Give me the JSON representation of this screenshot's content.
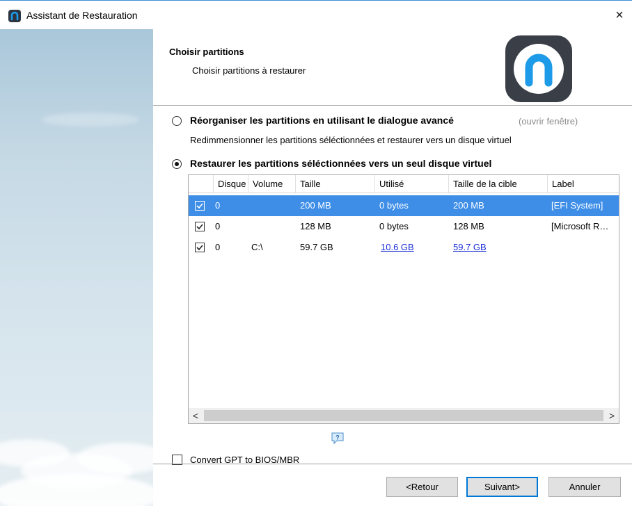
{
  "window": {
    "title": "Assistant de Restauration",
    "close_glyph": "×"
  },
  "header": {
    "title": "Choisir partitions",
    "subtitle": "Choisir partitions à restaurer"
  },
  "options": [
    {
      "label": "Réorganiser les partitions en utilisant le dialogue avancé",
      "link": "(ouvrir fenêtre)",
      "description": "Redimmensionner les partitions séléctionnées et restaurer vers un disque virtuel",
      "checked": false
    },
    {
      "label": "Restaurer les partitions séléctionnées vers un seul disque virtuel",
      "checked": true
    }
  ],
  "table": {
    "columns": [
      "Disque",
      "Volume",
      "Taille",
      "Utilisé",
      "Taille de la cible",
      "Label"
    ],
    "rows": [
      {
        "disk": "0",
        "volume": "",
        "size": "200 MB",
        "used": "0 bytes",
        "target": "200 MB",
        "label": "[EFI System]",
        "checked": true,
        "selected": true
      },
      {
        "disk": "0",
        "volume": "",
        "size": "128 MB",
        "used": "0 bytes",
        "target": "128 MB",
        "label": "[Microsoft R…",
        "checked": true,
        "selected": false
      },
      {
        "disk": "0",
        "volume": "C:\\",
        "size": "59.7 GB",
        "used": "10.6 GB",
        "target": "59.7 GB",
        "label": "",
        "checked": true,
        "selected": false
      }
    ],
    "scroll_left": "<",
    "scroll_right": ">"
  },
  "convert_gpt": {
    "label": "Convert GPT to BIOS/MBR",
    "checked": false
  },
  "buttons": {
    "back": "<Retour",
    "next": "Suivant>",
    "cancel": "Annuler"
  },
  "colors": {
    "selection": "#3e8ee8",
    "link": "#1a2fd6",
    "primary_border": "#0078d7",
    "logo_bg": "#3a3f47",
    "logo_accent": "#1e9be8"
  },
  "icons": {
    "app": "app-logo-icon",
    "close": "close-icon",
    "help": "help-icon"
  }
}
